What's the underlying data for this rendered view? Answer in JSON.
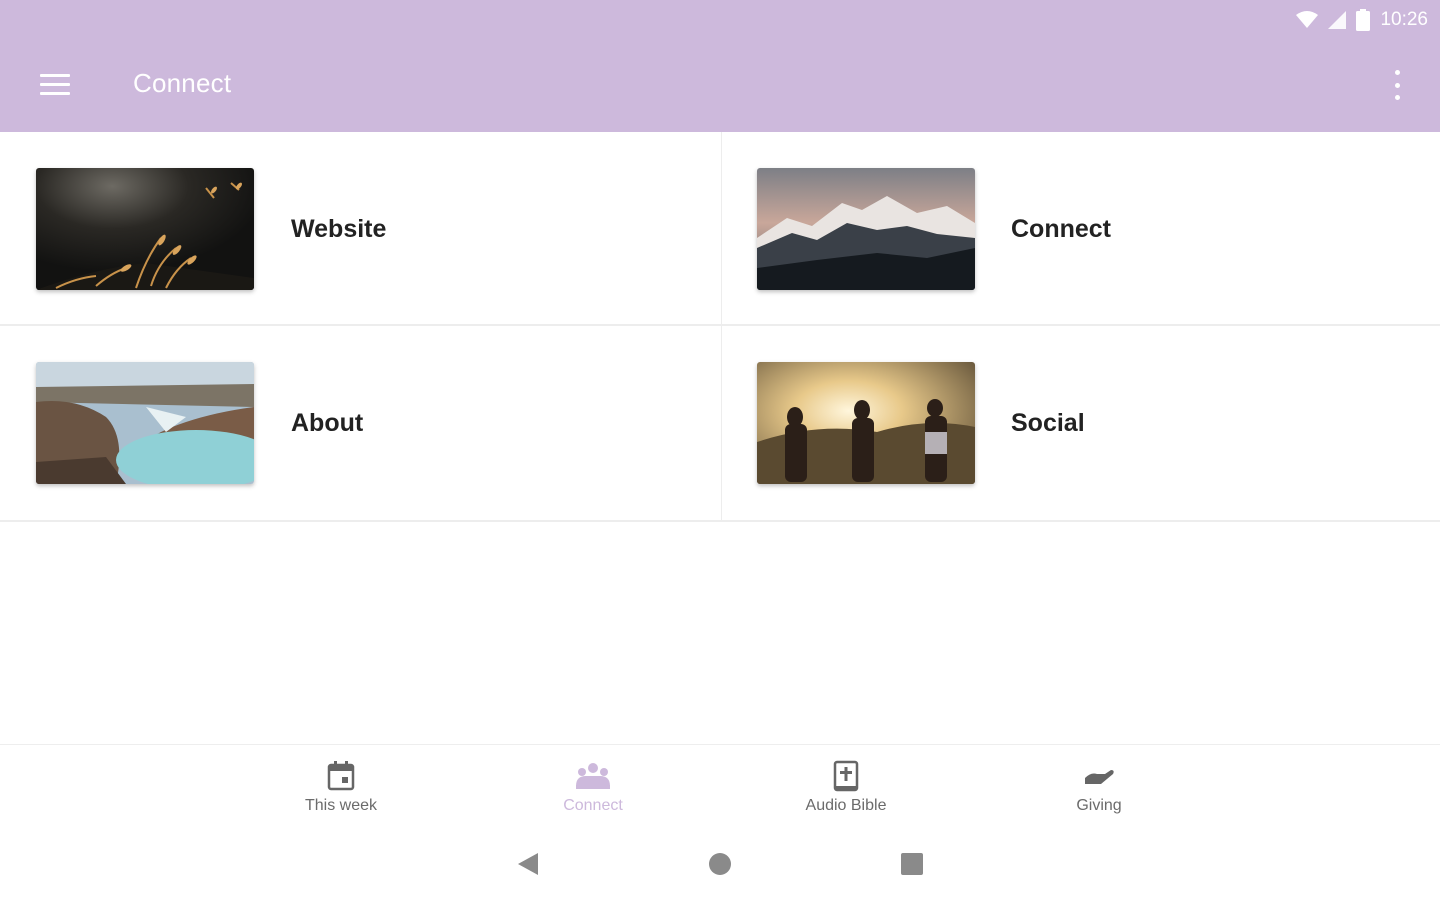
{
  "colors": {
    "appbar": "#cdb9dc",
    "accent": "#cdb9dc",
    "text": "#222222",
    "muted": "#6b6b6b"
  },
  "status": {
    "time": "10:26",
    "icons": [
      "wifi-icon",
      "cell-signal-icon",
      "battery-icon"
    ]
  },
  "toolbar": {
    "title": "Connect",
    "menu_icon": "hamburger-menu-icon",
    "overflow_icon": "more-vert-icon"
  },
  "tiles": [
    {
      "label": "Website",
      "image": "dark-grass-photo"
    },
    {
      "label": "Connect",
      "image": "snowy-mountains-photo"
    },
    {
      "label": "About",
      "image": "crater-lake-photo"
    },
    {
      "label": "Social",
      "image": "people-sunset-photo"
    }
  ],
  "bottom_nav": [
    {
      "label": "This week",
      "icon": "calendar-icon",
      "active": false
    },
    {
      "label": "Connect",
      "icon": "group-icon",
      "active": true
    },
    {
      "label": "Audio Bible",
      "icon": "bible-icon",
      "active": false
    },
    {
      "label": "Giving",
      "icon": "hand-giving-icon",
      "active": false
    }
  ],
  "system_nav": [
    "back-icon",
    "home-icon",
    "recents-icon"
  ]
}
